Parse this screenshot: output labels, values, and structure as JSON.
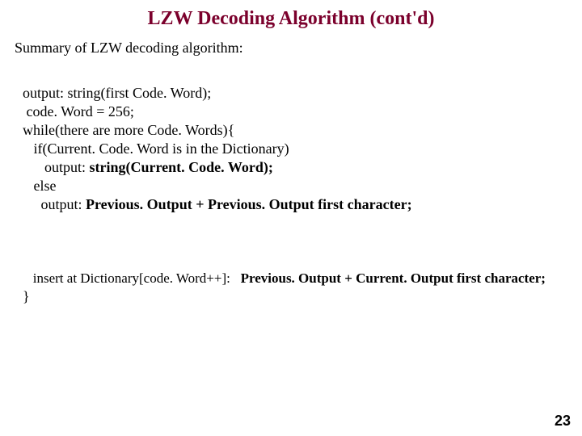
{
  "title": "LZW Decoding Algorithm (cont'd)",
  "summary": "Summary of LZW decoding algorithm:",
  "code": {
    "l1": "output: string(first Code. Word);",
    "l2": " code. Word = 256;",
    "l3": "while(there are more Code. Words){",
    "l4": "   if(Current. Code. Word is in the Dictionary)",
    "l5a": "      output: ",
    "l5b": "string(Current. Code. Word);",
    "l6": "   else",
    "l7a": "     output: ",
    "l7b": "Previous. Output + Previous. Output first character;"
  },
  "insert": {
    "a": "   insert at Dictionary[code. Word++]:   ",
    "b": "Previous. Output + Current. Output first character;"
  },
  "closebrace": "}",
  "pagenum": "23"
}
